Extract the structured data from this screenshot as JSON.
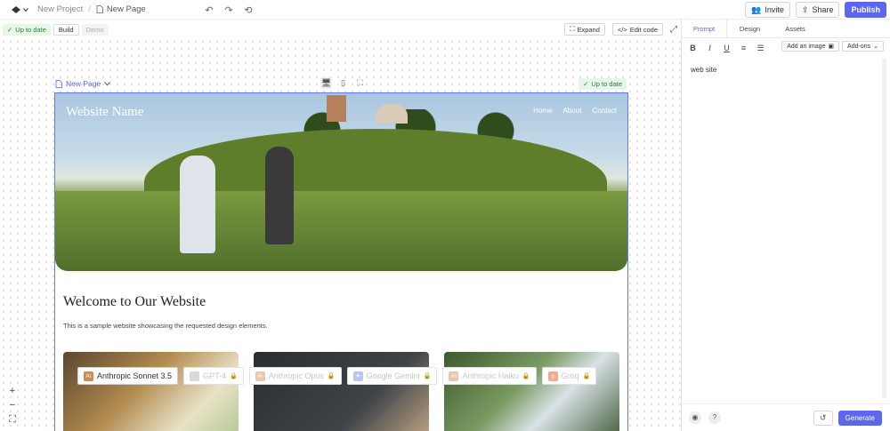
{
  "topbar": {
    "project": "New Project",
    "separator": "/",
    "page": "New Page",
    "invite_label": "Invite",
    "share_label": "Share",
    "publish_label": "Publish"
  },
  "subbar": {
    "status": "Up to date",
    "build_label": "Build",
    "demo_label": "Demo",
    "expand_label": "Expand",
    "edit_code_label": "Edit code"
  },
  "frame": {
    "page_name": "New Page",
    "status": "Up to date"
  },
  "site": {
    "name": "Website Name",
    "nav": [
      "Home",
      "About",
      "Contact"
    ],
    "welcome": "Welcome to Our Website",
    "description": "This is a sample website showcasing the requested design elements."
  },
  "zoom": {
    "plus": "+",
    "minus": "−",
    "fit": "⛶"
  },
  "models": [
    {
      "label": "Anthropic Sonnet 3.5",
      "active": true,
      "color": "#c98b5a",
      "icon": "A\\"
    },
    {
      "label": "GPT-4",
      "active": false,
      "color": "#d9d9d9",
      "icon": ""
    },
    {
      "label": "Anthropic Opus",
      "active": false,
      "color": "#e8c7ad",
      "icon": "A\\"
    },
    {
      "label": "Google Gemini",
      "active": false,
      "color": "#b9c8f2",
      "icon": "✦"
    },
    {
      "label": "Anthropic Haiku",
      "active": false,
      "color": "#e8c7ad",
      "icon": "A\\"
    },
    {
      "label": "Groq",
      "active": false,
      "color": "#f2a98c",
      "icon": "g"
    }
  ],
  "panel": {
    "tabs": [
      "Prompt",
      "Design",
      "Assets"
    ],
    "format": [
      "B",
      "I",
      "U",
      "≡",
      "☰"
    ],
    "add_image_label": "Add an image",
    "addons_label": "Add-ons",
    "prompt_text": "web site",
    "help": "?",
    "generate_label": "Generate"
  }
}
